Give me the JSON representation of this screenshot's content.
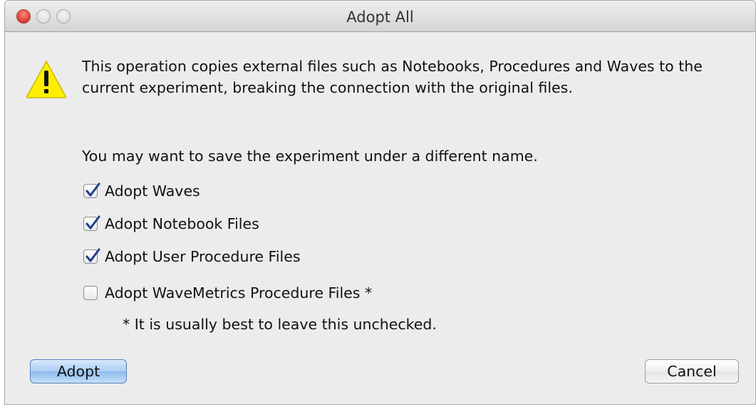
{
  "window": {
    "title": "Adopt All"
  },
  "message": "This operation copies external files such as Notebooks, Procedures and Waves to the current experiment, breaking the connection with the original files.",
  "note": "You may want to save the experiment under a different name.",
  "options": [
    {
      "label": "Adopt Waves",
      "checked": true
    },
    {
      "label": "Adopt Notebook Files",
      "checked": true
    },
    {
      "label": "Adopt User Procedure Files",
      "checked": true
    },
    {
      "label": "Adopt WaveMetrics Procedure Files *",
      "checked": false
    }
  ],
  "footnote": "* It is usually best to leave this unchecked.",
  "buttons": {
    "adopt": "Adopt",
    "cancel": "Cancel"
  },
  "icons": {
    "warning": "warning-icon",
    "check": "checkmark-icon"
  },
  "colors": {
    "warning_fill": "#ffee00",
    "default_button": "#a9cdf4"
  }
}
